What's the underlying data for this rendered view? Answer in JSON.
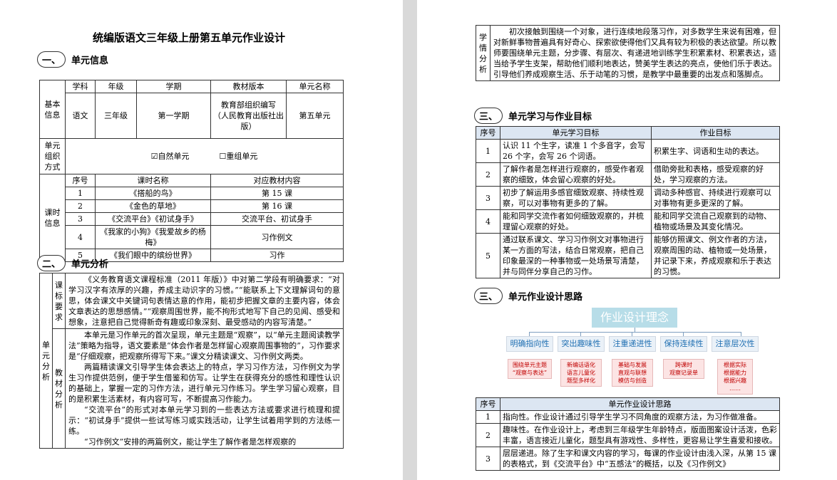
{
  "doc": {
    "title": "统编版语文三年级上册第五单元作业设计",
    "sec1": {
      "num": "一、",
      "label": "单元信息"
    },
    "sec2": {
      "num": "二、",
      "label": "单元分析"
    },
    "sec3": {
      "num": "三、",
      "label": "单元学习与作业目标"
    },
    "sec4": {
      "num": "三、",
      "label": "单元作业设计思路"
    }
  },
  "info_table": {
    "headers": [
      "学科",
      "年级",
      "学期",
      "教材版本",
      "单元名称"
    ],
    "basic_label": "基本信息",
    "basic_values": [
      "语文",
      "三年级",
      "第一学期",
      "教育部组织编写\n（人民教育出版社出版）",
      "第五单元"
    ],
    "org_label": "单元组织方式",
    "org_natural": "☑自然单元",
    "org_regroup": "☐重组单元",
    "lesson_label": "课时信息",
    "lesson_headers": [
      "序号",
      "课时名称",
      "对应教材内容"
    ],
    "lessons": [
      {
        "no": "1",
        "name": "《搭船的鸟》",
        "content": "第 15 课"
      },
      {
        "no": "2",
        "name": "《金色的草地》",
        "content": "第 16 课"
      },
      {
        "no": "3",
        "name": "《交流平台》《初试身手》",
        "content": "交流平台、初试身手"
      },
      {
        "no": "4",
        "name": "《我家的小狗》《我爱故乡的杨梅》",
        "content": "习作例文"
      },
      {
        "no": "5",
        "name": "《我们眼中的缤纷世界》",
        "content": "习作"
      }
    ]
  },
  "analysis": {
    "outer_label": "单元分析",
    "std_label": "课标要求",
    "std_text": "《义务教育语文课程标准（2011 年版）》中对第二学段有明确要求：“对学习汉字有浓厚的兴趣，养成主动识字的习惯。”“能联系上下文理解词句的意思，体会课文中关键词句表情达意的作用，能初步把握文章的主要内容，体会文章表达的思想感情。”“观察周围世界，能不拘形式地写下自己的见闻、感受和想象，注意把自己觉得新奇有趣或印象深刻、最受感动的内容写清楚。”",
    "text_label": "教材分析",
    "text_paras": [
      "本单元是习作单元的首次呈现，单元主题是“观察”，以“单元主题阅读教学法”策略为指导，语文要素是“体会作者是怎样留心观察周围事物的”，习作要求是“仔细观察，把观察所得写下来。”课文分精读课文、习作例文两类。",
      "两篇精读课文引导学生体会表达上的特点，学习习作方法，习作例文为学生习作提供范例，便于学生借鉴和仿写。让学生在获得充分的感性和理性认识的基础上，掌握一定的习作方法，进行单元习作练习。学生学习留心观察，目的是积累生活素材，有内容可写，不断提高习作能力。",
      "“交流平台”的形式对本单元学习到的一些表达方法或要求进行梳理和提示：“初试身手”提供一些试写练习或实践活动，让学生试着用学到的方法练一练。",
      "“习作例文”安排的两篇例文，能让学生了解作者是怎样观察的"
    ],
    "learner_label": "学情分析",
    "learner_text": "初次接触到围绕一个对象，进行连续地段落习作，对多数学生来说有困难，但对新鲜事物普遍具有好奇心、探索欲使得他们又具有较为积极的表达欲望。所以教师要围绕单元主题，分步骤、有层次、有递进地训练学生积累素材、积累表达，适当给予学生支架，帮助他们顺利地表达，赞美学生表达的亮点，使他们乐于表达。引导他们养成观察生活、乐于动笔的习惯，是教学中最重要的出发点和落脚点。"
  },
  "goals": {
    "headers": [
      "序号",
      "单元学习目标",
      "作业目标"
    ],
    "rows": [
      {
        "no": "1",
        "learn": "认识 11 个生字，读准 1 个多音字，会写 26 个字，会写 26 个词语。",
        "work": "积累生字、词语和生动的表达。"
      },
      {
        "no": "2",
        "learn": "了解作者是怎样进行观察的，感受作者观察的细致，体会留心观察的好处。",
        "work": "借助旁批和表格，感受观察的好处，学习观察的方法。"
      },
      {
        "no": "3",
        "learn": "初步了解运用多感官细致观察、持续性观察，可以对事物有更多的了解。",
        "work": "调动多种感官、持续进行观察可以对事物有更多更深的了解。"
      },
      {
        "no": "4",
        "learn": "能和同学交流作者如何细致观察的，并梳理留心观察的好处。",
        "work": "能和同学交流自己观察到的动物、植物或场景及其变化情况。"
      },
      {
        "no": "5",
        "learn": "通过联系课文、学习习作例文对事物进行某一方面的写法，结合日常观察，把自己印象最深的一种事物或一处场景写清楚，并与同伴分享自己的习作。",
        "work": "能够仿照课文、例文作者的方法，观察周围的动、植物或一处场景，并记录下来，养成观察和乐于表达的习惯。"
      }
    ]
  },
  "diagram": {
    "title": "作业设计理念",
    "branches": [
      {
        "label": "明确指向性",
        "sub": "围绕单元主题\n“观察与表达”"
      },
      {
        "label": "突出趣味性",
        "sub": "新编话语化\n语言儿童化\n题型多样化"
      },
      {
        "label": "注重递进性",
        "sub": "基础与发展\n直观与联想\n模仿与创造"
      },
      {
        "label": "保持连续性",
        "sub": "跨课时\n观察记录单"
      },
      {
        "label": "注意层次性",
        "sub": "根据实际\n根据能力\n根据兴趣\n……"
      }
    ]
  },
  "ideas": {
    "headers": [
      "序号",
      "单元作业设计思路"
    ],
    "rows": [
      {
        "no": "1",
        "text": "指向性。作业设计通过引导学生学习不同角度的观察方法，为习作做准备。"
      },
      {
        "no": "2",
        "text": "趣味性。在作业设计上，考虑到三年级学生年龄特点，版面图案设计活泼，色彩丰富，语言接近儿童化，题型具有游戏性、多样性，更容易让学生喜爱和接收。"
      },
      {
        "no": "3",
        "text": "层层递进。除了生字和课文内容的学习，每课的作业设计由浅入深，从第 15 课的表格式，到《交流平台》中“五感法”的概括，以及《习作例文》"
      }
    ]
  }
}
